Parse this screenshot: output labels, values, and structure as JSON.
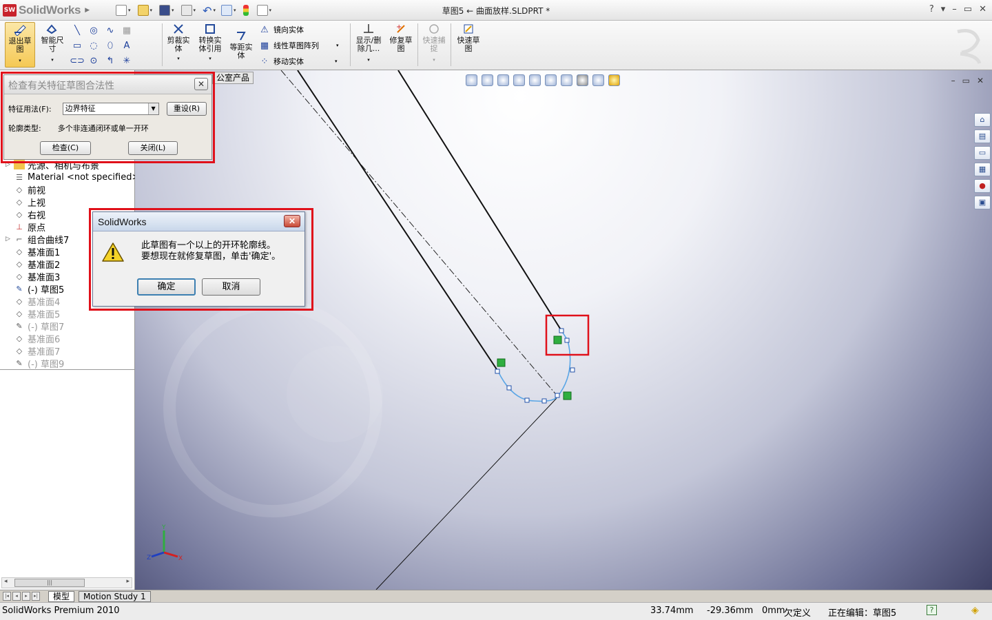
{
  "app": {
    "logo_text": "SolidWorks",
    "window_title": "草图5 ← 曲面放样.SLDPRT *",
    "window_controls": [
      "?",
      "▾",
      "–",
      "▭",
      "✕"
    ]
  },
  "commands": {
    "exit_sketch": "退出草图",
    "smart_dim": "智能尺寸",
    "trim": "剪裁实体",
    "convert": "转换实体引用",
    "offset": "等距实体",
    "mirror": "镜向实体",
    "linear_pattern": "线性草图阵列",
    "move": "移动实体",
    "show_delete": "显示/删除几...",
    "repair": "修复草图",
    "quick_snap": "快速捕捉",
    "rapid_sketch": "快速草图"
  },
  "pane_tab": "公室产品",
  "check_dialog": {
    "title": "检查有关特征草图合法性",
    "usage_label": "特征用法(F):",
    "usage_value": "边界特征",
    "reset_btn": "重设(R)",
    "contour_label": "轮廓类型:",
    "contour_value": "多个非连通闭环或单一开环",
    "check_btn": "检查(C)",
    "close_btn": "关闭(L)"
  },
  "tree": [
    {
      "label": "光源、相机与布景",
      "icon": "light-icon",
      "dim": false
    },
    {
      "label": "Material <not specified>",
      "icon": "material-icon",
      "dim": false
    },
    {
      "label": "前视",
      "icon": "plane-icon",
      "dim": false
    },
    {
      "label": "上视",
      "icon": "plane-icon",
      "dim": false
    },
    {
      "label": "右视",
      "icon": "plane-icon",
      "dim": false
    },
    {
      "label": "原点",
      "icon": "origin-icon",
      "dim": false
    },
    {
      "label": "组合曲线7",
      "icon": "curve-icon",
      "dim": false
    },
    {
      "label": "基准面1",
      "icon": "plane-icon",
      "dim": false
    },
    {
      "label": "基准面2",
      "icon": "plane-icon",
      "dim": false
    },
    {
      "label": "基准面3",
      "icon": "plane-icon",
      "dim": false
    },
    {
      "label": "(-) 草图5",
      "icon": "sketch-icon",
      "dim": false
    },
    {
      "label": "基准面4",
      "icon": "plane-icon",
      "dim": true
    },
    {
      "label": "基准面5",
      "icon": "plane-icon",
      "dim": true
    },
    {
      "label": "(-) 草图7",
      "icon": "sketch-icon",
      "dim": true
    },
    {
      "label": "基准面6",
      "icon": "plane-icon",
      "dim": true
    },
    {
      "label": "基准面7",
      "icon": "plane-icon",
      "dim": true
    },
    {
      "label": "(-) 草图9",
      "icon": "sketch-icon",
      "dim": true
    }
  ],
  "message_box": {
    "title": "SolidWorks",
    "line1": "此草图有一个以上的开环轮廓线。",
    "line2": "要想现在就修复草图，单击'确定'。",
    "ok": "确定",
    "cancel": "取消"
  },
  "bottom_tabs": [
    "模型",
    "Motion Study 1"
  ],
  "status": {
    "product": "SolidWorks Premium 2010",
    "x": "33.74mm",
    "y": "-29.36mm",
    "z": "0mm",
    "state": "欠定义",
    "editing": "正在编辑：草图5"
  },
  "triad": {
    "x": "X",
    "y": "Y",
    "z": "Z"
  },
  "colors": {
    "highlight": "#e0101a",
    "sketch_arc": "#5aa6e6",
    "relation_marker": "#2fae3f"
  }
}
